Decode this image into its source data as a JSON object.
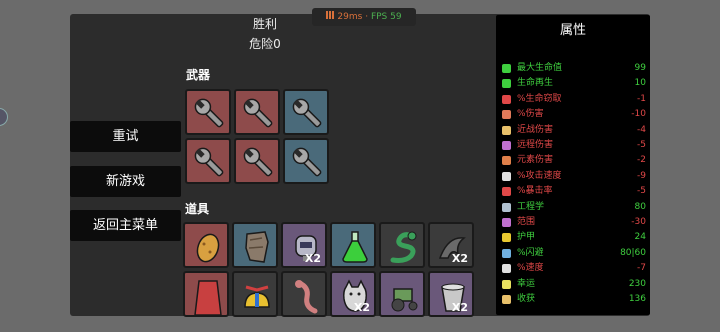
{
  "header": {
    "result": "胜利",
    "danger": "危险0"
  },
  "perf": {
    "ms": "29ms",
    "sep": "·",
    "fps": "FPS 59"
  },
  "sections": {
    "weapons": "武器",
    "items": "道具"
  },
  "buttons": {
    "retry": "重试",
    "new_game": "新游戏",
    "main_menu": "返回主菜单"
  },
  "colors": {
    "tier_red": "#8e4b4b",
    "tier_blue": "#4a6a7a",
    "stat_positive": "#3fcf3f",
    "stat_negative": "#e04848"
  },
  "weapons": [
    {
      "icon": "wrench-icon",
      "tier": "red"
    },
    {
      "icon": "wrench-icon",
      "tier": "red"
    },
    {
      "icon": "wrench-icon",
      "tier": "blue"
    },
    {
      "icon": "wrench-icon",
      "tier": "red"
    },
    {
      "icon": "wrench-icon",
      "tier": "red"
    },
    {
      "icon": "wrench-icon",
      "tier": "blue"
    }
  ],
  "items": [
    {
      "icon": "potato-icon",
      "tier": "red",
      "count": ""
    },
    {
      "icon": "torn-cloth-icon",
      "tier": "blue",
      "count": ""
    },
    {
      "icon": "robot-helmet-icon",
      "tier": "purple",
      "count": "X2"
    },
    {
      "icon": "potion-flask-icon",
      "tier": "blue",
      "count": ""
    },
    {
      "icon": "snake-icon",
      "tier": "dark",
      "count": ""
    },
    {
      "icon": "dark-tentacle-icon",
      "tier": "dark",
      "count": "X2"
    },
    {
      "icon": "red-cape-icon",
      "tier": "red",
      "count": ""
    },
    {
      "icon": "propeller-hat-icon",
      "tier": "dark",
      "count": ""
    },
    {
      "icon": "lizard-icon",
      "tier": "dark",
      "count": ""
    },
    {
      "icon": "cat-icon",
      "tier": "purple",
      "count": "X2"
    },
    {
      "icon": "tractor-icon",
      "tier": "purple",
      "count": ""
    },
    {
      "icon": "bucket-icon",
      "tier": "purple",
      "count": "X2"
    }
  ],
  "stats": {
    "title": "属性",
    "rows": [
      {
        "icon": "heart-icon",
        "icon_color": "#3fcf3f",
        "name": "最大生命值",
        "value": "99",
        "positive": true
      },
      {
        "icon": "regen-icon",
        "icon_color": "#3fcf3f",
        "name": "生命再生",
        "value": "10",
        "positive": true
      },
      {
        "icon": "lifesteal-icon",
        "icon_color": "#e04848",
        "name": "%生命窃取",
        "value": "-1",
        "positive": false
      },
      {
        "icon": "damage-icon",
        "icon_color": "#e07a5a",
        "name": "%伤害",
        "value": "-10",
        "positive": false
      },
      {
        "icon": "sword-icon",
        "icon_color": "#e8c06a",
        "name": "近战伤害",
        "value": "-4",
        "positive": false
      },
      {
        "icon": "ranged-icon",
        "icon_color": "#c070d0",
        "name": "远程伤害",
        "value": "-5",
        "positive": false
      },
      {
        "icon": "flame-icon",
        "icon_color": "#e0804a",
        "name": "元素伤害",
        "value": "-2",
        "positive": false
      },
      {
        "icon": "hourglass-icon",
        "icon_color": "#e0e0e0",
        "name": "%攻击速度",
        "value": "-9",
        "positive": false
      },
      {
        "icon": "crit-icon",
        "icon_color": "#e04848",
        "name": "%暴击率",
        "value": "-5",
        "positive": false
      },
      {
        "icon": "engineering-icon",
        "icon_color": "#b0c0d0",
        "name": "工程学",
        "value": "80",
        "positive": true
      },
      {
        "icon": "range-icon",
        "icon_color": "#c070d0",
        "name": "范围",
        "value": "-30",
        "positive": false
      },
      {
        "icon": "shield-icon",
        "icon_color": "#e8c830",
        "name": "护甲",
        "value": "24",
        "positive": true
      },
      {
        "icon": "dodge-icon",
        "icon_color": "#70b0e0",
        "name": "%闪避",
        "value": "80|60",
        "positive": true
      },
      {
        "icon": "speed-icon",
        "icon_color": "#e0e0e0",
        "name": "%速度",
        "value": "-7",
        "positive": false
      },
      {
        "icon": "luck-icon",
        "icon_color": "#e8e060",
        "name": "幸运",
        "value": "230",
        "positive": true
      },
      {
        "icon": "harvest-icon",
        "icon_color": "#e8c06a",
        "name": "收获",
        "value": "136",
        "positive": true
      }
    ]
  }
}
